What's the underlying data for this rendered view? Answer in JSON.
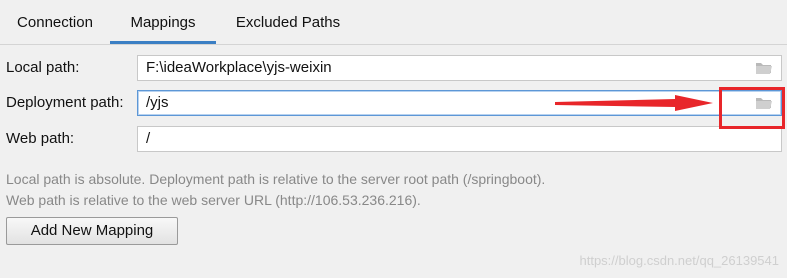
{
  "tabs": [
    {
      "label": "Connection",
      "active": false
    },
    {
      "label": "Mappings",
      "active": true
    },
    {
      "label": "Excluded Paths",
      "active": false
    }
  ],
  "form": {
    "local_path_label": "Local path:",
    "local_path_value": "F:\\ideaWorkplace\\yjs-weixin",
    "deployment_path_label": "Deployment path:",
    "deployment_path_value": "/yjs",
    "web_path_label": "Web path:",
    "web_path_value": "/"
  },
  "hints": {
    "line1": "Local path is absolute. Deployment path is relative to the server root path (/springboot).",
    "line2": "Web path is relative to the web server URL (http://106.53.236.216)."
  },
  "buttons": {
    "add_mapping": "Add New Mapping"
  },
  "icons": {
    "browse": "folder-icon"
  },
  "colors": {
    "accent": "#3b7fc4",
    "annotation": "#e8262a"
  },
  "watermark": "https://blog.csdn.net/qq_26139541"
}
